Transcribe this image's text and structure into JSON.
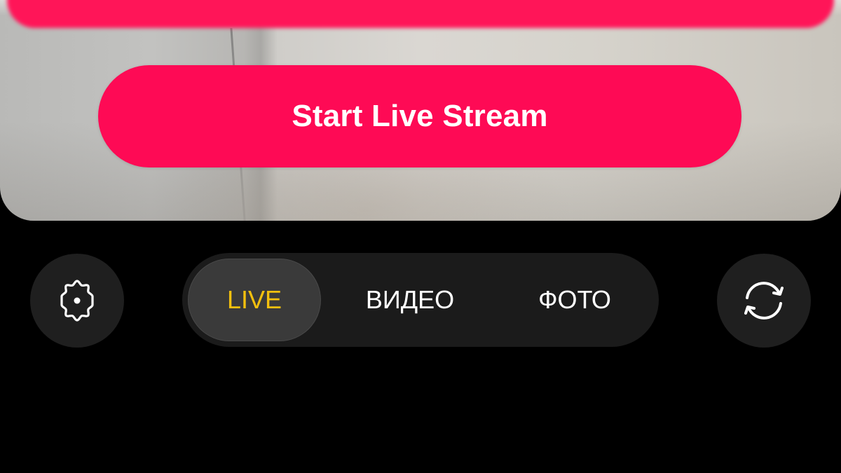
{
  "preview": {
    "start_button_label": "Start Live Stream"
  },
  "modes": [
    {
      "label": "LIVE",
      "selected": true
    },
    {
      "label": "ВИДЕО",
      "selected": false
    },
    {
      "label": "ФОТО",
      "selected": false
    }
  ],
  "icons": {
    "settings": "gear-icon",
    "flip_camera": "camera-flip-icon"
  },
  "colors": {
    "start_button": "#fe0a55",
    "selected_mode_text": "#f4c00e",
    "background": "#000000"
  }
}
